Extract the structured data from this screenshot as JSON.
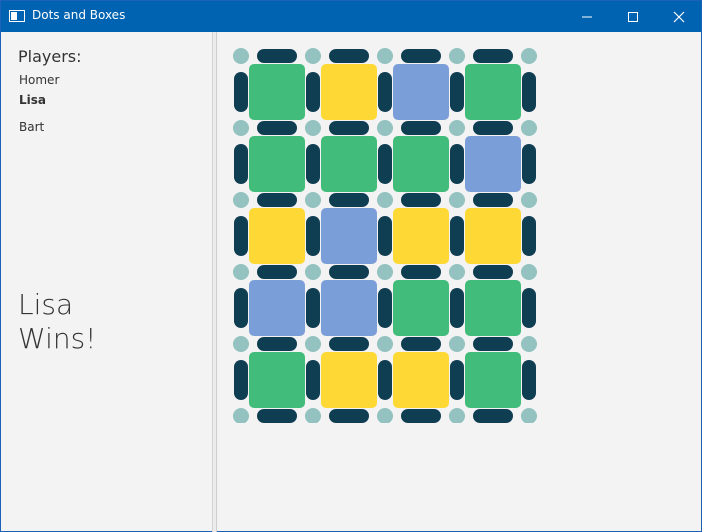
{
  "window": {
    "title": "Dots and Boxes"
  },
  "sidebar": {
    "players_heading": "Players:",
    "players": [
      "Homer",
      "Lisa",
      "Bart"
    ],
    "active_player_index": 1,
    "result_line1": "Lisa",
    "result_line2": "Wins!"
  },
  "colors": {
    "titlebar": "#0063b1",
    "dot": "#93c2c0",
    "line": "#0f3d52",
    "green": "#41bc7a",
    "yellow": "#fed935",
    "blue": "#799ed8"
  },
  "board": {
    "columns": 4,
    "rows": 5,
    "box_colors": [
      [
        "green",
        "yellow",
        "blue",
        "green"
      ],
      [
        "green",
        "green",
        "green",
        "blue"
      ],
      [
        "yellow",
        "blue",
        "yellow",
        "yellow"
      ],
      [
        "blue",
        "blue",
        "green",
        "green"
      ],
      [
        "green",
        "yellow",
        "yellow",
        "green"
      ]
    ]
  }
}
